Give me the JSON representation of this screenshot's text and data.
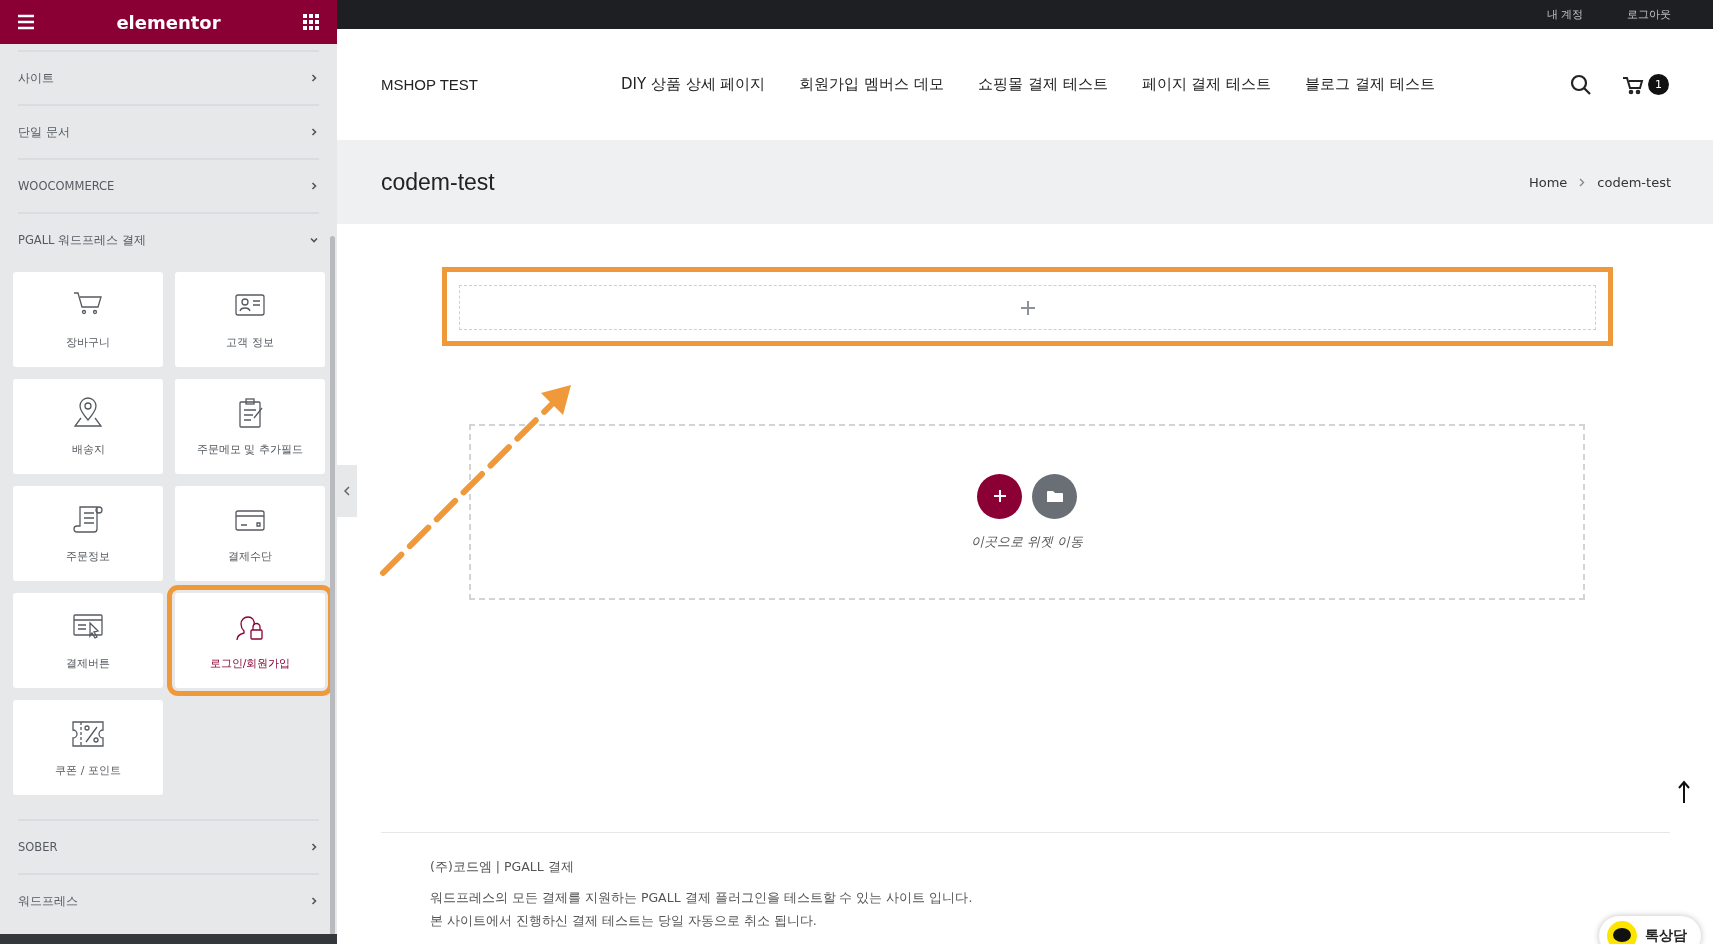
{
  "editor_panel": {
    "logo": "elementor",
    "categories_top": [
      {
        "label": "사이트",
        "expanded": false
      },
      {
        "label": "단일 문서",
        "expanded": false
      },
      {
        "label": "WOOCOMMERCE",
        "expanded": false
      },
      {
        "label": "PGALL 워드프레스 결제",
        "expanded": true
      }
    ],
    "widgets": [
      {
        "label": "장바구니",
        "kind": "cart",
        "highlighted": false
      },
      {
        "label": "고객 정보",
        "kind": "id-card",
        "highlighted": false
      },
      {
        "label": "배송지",
        "kind": "map-pin",
        "highlighted": false
      },
      {
        "label": "주문메모 및 추가필드",
        "kind": "clipboard",
        "highlighted": false
      },
      {
        "label": "주문정보",
        "kind": "receipt",
        "highlighted": false
      },
      {
        "label": "결제수단",
        "kind": "card",
        "highlighted": false
      },
      {
        "label": "결제버튼",
        "kind": "click",
        "highlighted": false
      },
      {
        "label": "로그인/회원가입",
        "kind": "user-lock",
        "highlighted": true
      },
      {
        "label": "쿠폰 / 포인트",
        "kind": "coupon",
        "highlighted": false
      }
    ],
    "categories_bottom": [
      {
        "label": "SOBER",
        "expanded": false
      },
      {
        "label": "워드프레스",
        "expanded": false
      }
    ]
  },
  "site": {
    "top_links": [
      "내 계정",
      "로그아웃"
    ],
    "brand": "MSHOP TEST",
    "nav": [
      "DIY 상품 상세 페이지",
      "회원가입 멤버스 데모",
      "쇼핑몰 결제 테스트",
      "페이지 결제 테스트",
      "블로그 결제 테스트"
    ],
    "cart_count": "1",
    "page_title": "codem-test",
    "breadcrumb": [
      "Home",
      "codem-test"
    ],
    "drop_zone": {
      "highlighted": true
    },
    "empty_section": {
      "hint": "이곳으로 위젯 이동"
    },
    "footer": {
      "company": "(주)코드엠 | PGALL 결제",
      "lines": [
        "워드프레스의 모든 결제를 지원하는 PGALL 결제 플러그인을 테스트할 수 있는 사이트 입니다.",
        "본 사이트에서 진행하신 결제 테스트는 당일 자동으로 취소 됩니다."
      ]
    },
    "chat_button": "톡상담"
  }
}
